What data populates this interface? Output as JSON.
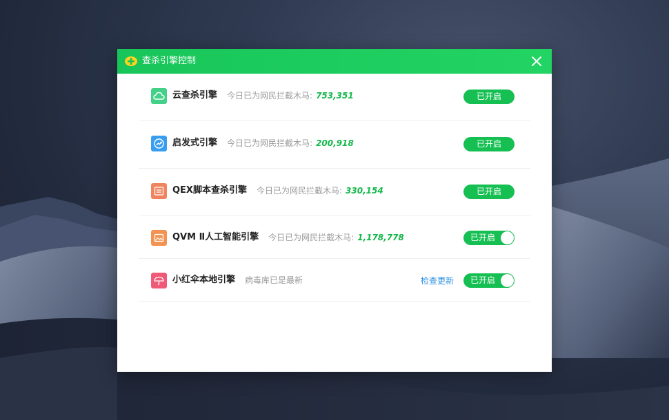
{
  "colors": {
    "accent_green": "#18c55a",
    "count_green": "#13b84a",
    "link_blue": "#2b8fe0"
  },
  "dialog": {
    "title": "查杀引擎控制",
    "title_icon": "360-logo-icon",
    "close_icon": "close-icon"
  },
  "engines": [
    {
      "name": "云查杀引擎",
      "icon": "cloud-icon",
      "icon_color": "#43d088",
      "desc": "今日已为网民拦截木马:",
      "count": "753,351",
      "status": "已开启",
      "status_style": "pill"
    },
    {
      "name": "启发式引擎",
      "icon": "trend-arrow-icon",
      "icon_color": "#3a9ef0",
      "desc": "今日已为网民拦截木马:",
      "count": "200,918",
      "status": "已开启",
      "status_style": "pill"
    },
    {
      "name": "QEX脚本查杀引擎",
      "icon": "script-document-icon",
      "icon_color": "#f0845e",
      "desc": "今日已为网民拦截木马:",
      "count": "330,154",
      "status": "已开启",
      "status_style": "pill"
    },
    {
      "name": "QVM Ⅱ人工智能引擎",
      "icon": "ai-image-icon",
      "icon_color": "#f39352",
      "desc": "今日已为网民拦截木马:",
      "count": "1,178,778",
      "status": "已开启",
      "status_style": "toggle"
    },
    {
      "name": "小红伞本地引擎",
      "icon": "umbrella-icon",
      "icon_color": "#ef5a78",
      "desc": "病毒库已是最新",
      "update_link": "检查更新",
      "status": "已开启",
      "status_style": "toggle"
    }
  ]
}
